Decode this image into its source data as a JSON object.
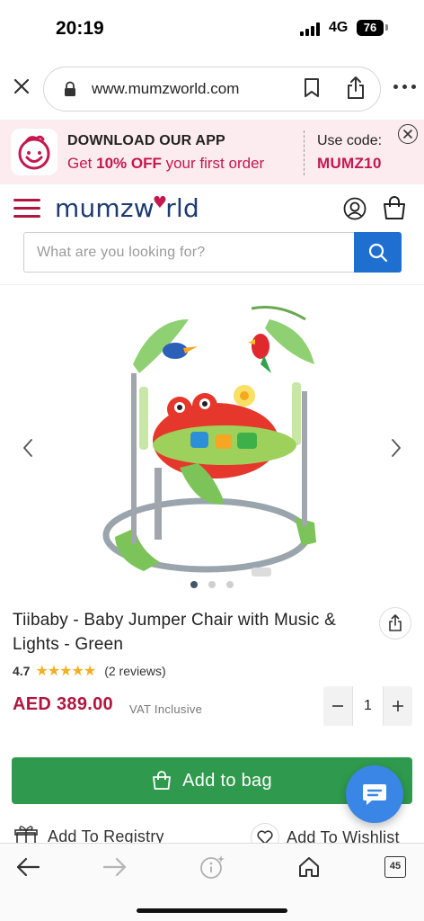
{
  "status": {
    "time": "20:19",
    "network": "4G",
    "battery": "76"
  },
  "browser": {
    "url": "www.mumzworld.com",
    "tab_count": "45"
  },
  "app_banner": {
    "title": "DOWNLOAD OUR APP",
    "sub_prefix": "Get ",
    "sub_bold": "10% OFF",
    "sub_suffix": " your first order",
    "code_label": "Use code:",
    "code": "MUMZ10"
  },
  "header": {
    "brand_left": "mumzw",
    "brand_heart": "♥",
    "brand_right": "rld"
  },
  "search": {
    "placeholder": "What are you looking for?"
  },
  "product": {
    "title": "Tiibaby - Baby Jumper Chair with Music & Lights - Green",
    "rating": "4.7",
    "stars": "★★★★★",
    "reviews": "(2 reviews)",
    "price": "AED 389.00",
    "vat": "VAT Inclusive",
    "quantity": "1",
    "add_to_bag": "Add to bag",
    "add_to_registry": "Add To Registry",
    "add_to_wishlist": "Add To Wishlist"
  },
  "icons": {
    "close": "close-icon",
    "lock": "lock-icon",
    "bookmark": "bookmark-icon",
    "share": "share-icon",
    "more": "more-icon",
    "menu": "hamburger-icon",
    "account": "account-icon",
    "bag": "bag-icon",
    "search": "search-icon",
    "chat": "chat-icon"
  },
  "colors": {
    "brand_primary": "#b2163f",
    "brand_navy": "#1e3a74",
    "search_button": "#1f6fd1",
    "add_to_bag": "#2f9a4d",
    "banner_bg": "#fcebef",
    "chat_bubble": "#3a86e6"
  }
}
